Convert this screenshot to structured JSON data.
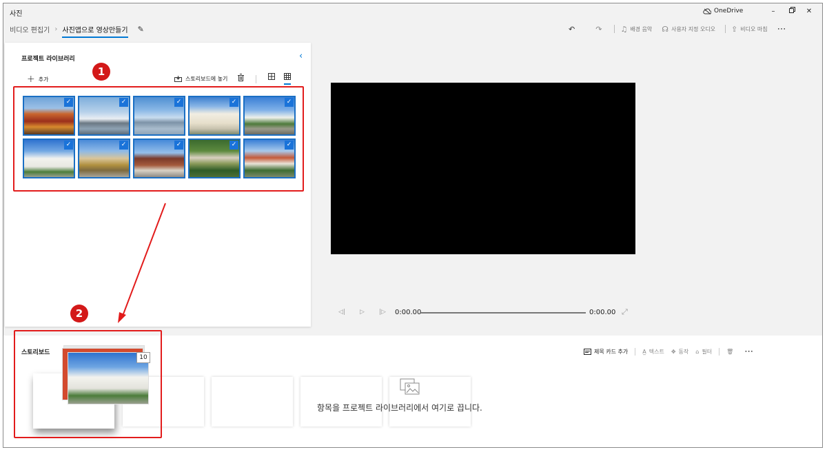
{
  "app": {
    "title": "사진"
  },
  "onedrive": {
    "label": "OneDrive"
  },
  "window": {
    "minimize": "–",
    "maximize": "□",
    "close": "✕"
  },
  "breadcrumb": {
    "parent": "비디오 편집기",
    "current": "사진앱으로 영상만들기"
  },
  "toolbar": {
    "background_music": "배경 음악",
    "custom_audio": "사용자 지정 오디오",
    "finish_video": "비디오 마침",
    "more": "⋯"
  },
  "library": {
    "title": "프로젝트 라이브러리",
    "add": "추가",
    "place_in_storyboard": "스토리보드에 놓기",
    "photos": [
      {
        "selected": true
      },
      {
        "selected": true
      },
      {
        "selected": true
      },
      {
        "selected": true
      },
      {
        "selected": true
      },
      {
        "selected": true
      },
      {
        "selected": true
      },
      {
        "selected": true
      },
      {
        "selected": true
      },
      {
        "selected": true
      }
    ]
  },
  "player": {
    "current_time": "0:00.00",
    "total_time": "0:00.00",
    "progress": 0
  },
  "storyboard": {
    "title": "스토리보드",
    "add_title_card": "제목 카드 추가",
    "text": "텍스트",
    "motion": "동작",
    "filter": "필터",
    "more": "⋯",
    "drop_hint": "항목을 프로젝트 라이브러리에서 여기로 끕니다.",
    "drag_count": "10"
  },
  "annotations": {
    "step1": "1",
    "step2": "2",
    "color": "#e21b1b"
  },
  "colors": {
    "accent": "#0078d4",
    "selection": "#1a73d9"
  }
}
